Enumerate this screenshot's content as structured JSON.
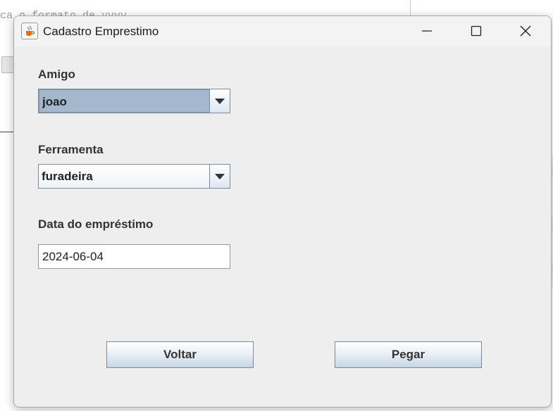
{
  "background": {
    "code_text": "ca o formato de yyyy"
  },
  "window": {
    "title": "Cadastro Emprestimo",
    "icon": "java-cup-icon",
    "controls": [
      "minimize-icon",
      "maximize-icon",
      "close-icon"
    ]
  },
  "form": {
    "amigo_label": "Amigo",
    "amigo_value": "joao",
    "ferramenta_label": "Ferramenta",
    "ferramenta_value": "furadeira",
    "data_label": "Data do empréstimo",
    "data_value": "2024-06-04"
  },
  "buttons": {
    "voltar": "Voltar",
    "pegar": "Pegar"
  },
  "colors": {
    "dialog_bg": "#eeeeee",
    "selected_combo": "#a3b8cc"
  }
}
